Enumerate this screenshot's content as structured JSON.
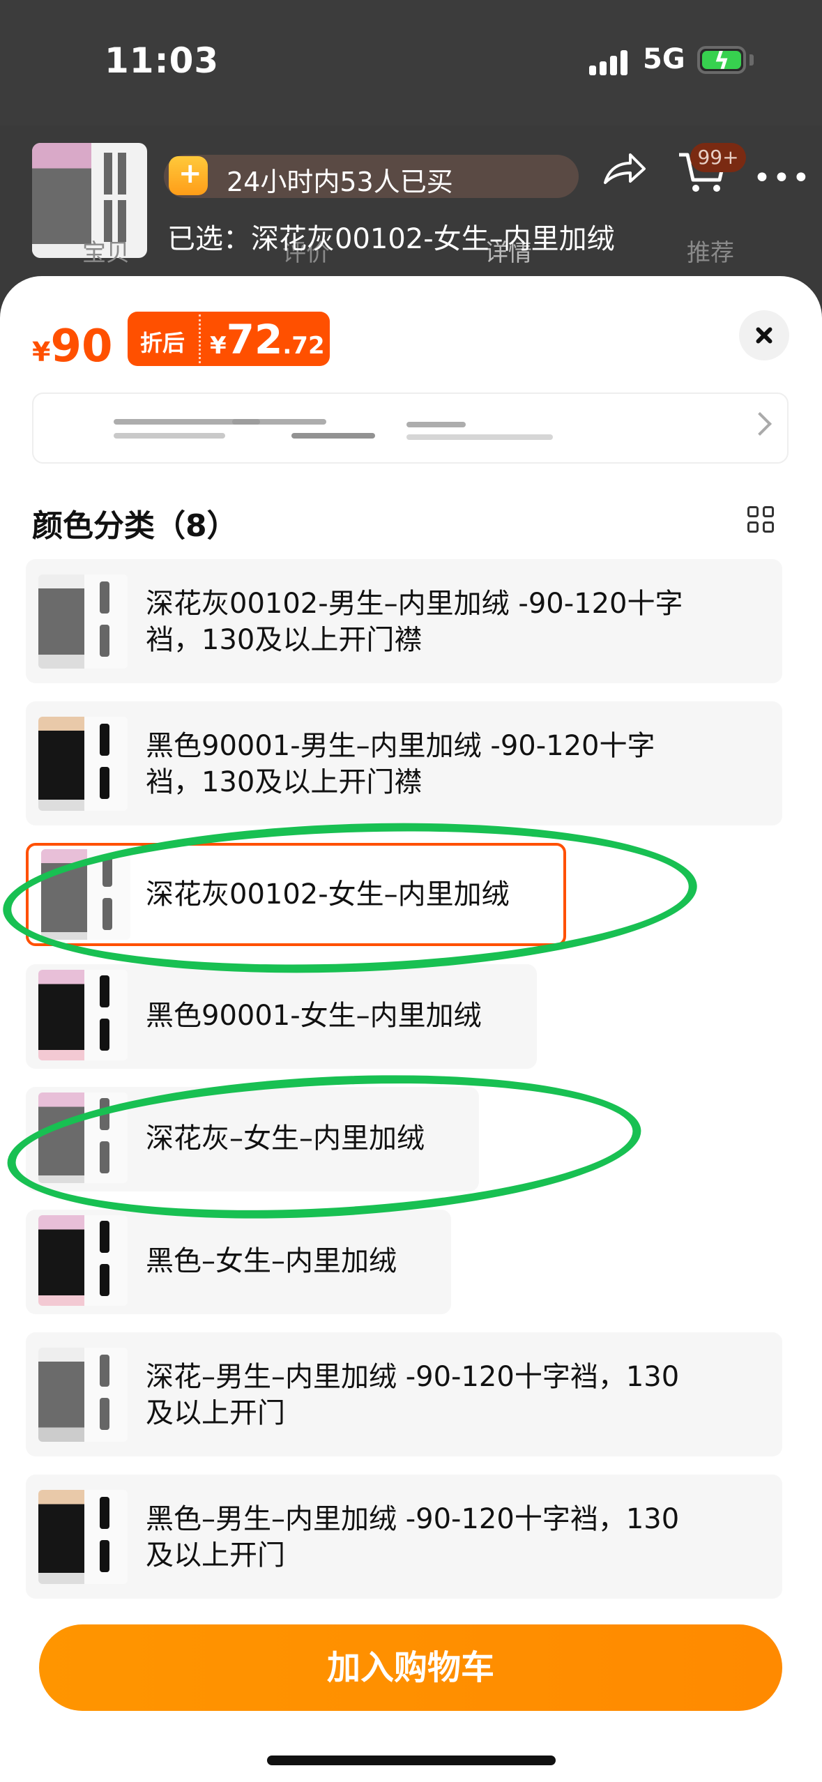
{
  "status_bar": {
    "time": "11:03",
    "network": "5G"
  },
  "header": {
    "buyers_badge": "24小时内53人已买",
    "selected": "已选：深花灰00102-女生–内里加绒",
    "tabs": [
      "宝贝",
      "评价",
      "详情",
      "推荐"
    ],
    "cart_badge": "99+"
  },
  "sheet": {
    "price_symbol": "¥",
    "price": "90",
    "discount_label": "折后",
    "discount_symbol": "¥",
    "discount_int": "72",
    "discount_dec": ".72",
    "section_title": "颜色分类（8）",
    "options": [
      {
        "label_line1": "深花灰00102-男生–内里加绒 -90-120十字",
        "label_line2": "裆，130及以上开门襟",
        "tone": "gray"
      },
      {
        "label_line1": "黑色90001-男生–内里加绒 -90-120十字",
        "label_line2": "裆，130及以上开门襟",
        "tone": "black"
      },
      {
        "label_line1": "深花灰00102-女生–内里加绒",
        "label_line2": "",
        "tone": "gray",
        "selected": true
      },
      {
        "label_line1": "黑色90001-女生–内里加绒",
        "label_line2": "",
        "tone": "black"
      },
      {
        "label_line1": "深花灰–女生–内里加绒",
        "label_line2": "",
        "tone": "gray"
      },
      {
        "label_line1": "黑色–女生–内里加绒",
        "label_line2": "",
        "tone": "black"
      },
      {
        "label_line1": "深花–男生–内里加绒 -90-120十字裆，130",
        "label_line2": "及以上开门",
        "tone": "gray"
      },
      {
        "label_line1": "黑色–男生–内里加绒 -90-120十字裆，130",
        "label_line2": "及以上开门",
        "tone": "black"
      }
    ],
    "add_to_cart": "加入购物车"
  },
  "colors": {
    "accent": "#ff5000",
    "button": "#ff9500",
    "annotation": "#18c052"
  }
}
